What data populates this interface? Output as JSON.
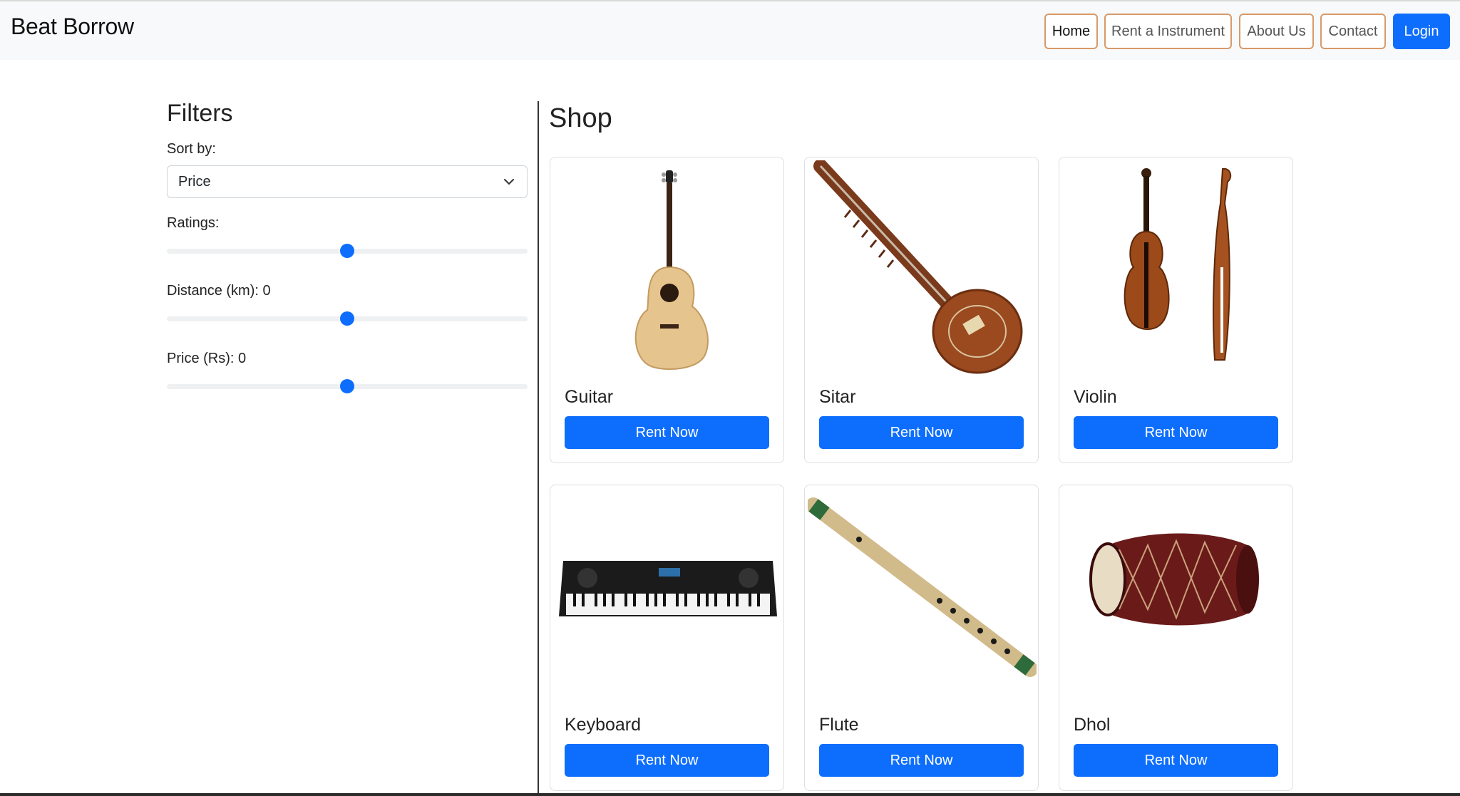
{
  "brand": "Beat Borrow",
  "nav": {
    "home": "Home",
    "rent": "Rent a Instrument",
    "about": "About Us",
    "contact": "Contact",
    "login": "Login"
  },
  "filters": {
    "title": "Filters",
    "sort_label": "Sort by:",
    "sort_value": "Price",
    "ratings_label": "Ratings:",
    "ratings_value": 0.5,
    "distance_label": "Distance (km): 0",
    "distance_value": 0.5,
    "price_label": "Price (Rs): 0",
    "price_value": 0.5
  },
  "shop": {
    "title": "Shop",
    "rent_label": "Rent Now",
    "products": [
      {
        "name": "Guitar"
      },
      {
        "name": "Sitar"
      },
      {
        "name": "Violin"
      },
      {
        "name": "Keyboard"
      },
      {
        "name": "Flute"
      },
      {
        "name": "Dhol"
      }
    ]
  },
  "colors": {
    "primary": "#0d6efd",
    "nav_border": "#d79a6a",
    "navbar_bg": "#f8f9fa"
  }
}
